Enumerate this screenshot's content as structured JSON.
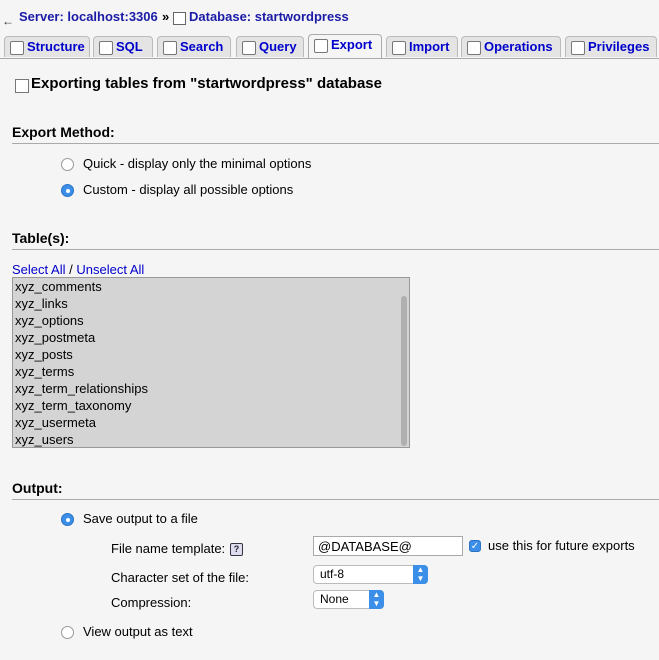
{
  "breadcrumb": {
    "back_arrow": "←",
    "server": "Server: localhost:3306",
    "separator": "»",
    "database": "Database: startwordpress"
  },
  "tabs": [
    {
      "label": "Structure",
      "icon": "structure-icon"
    },
    {
      "label": "SQL",
      "icon": "sql-icon"
    },
    {
      "label": "Search",
      "icon": "search-icon"
    },
    {
      "label": "Query",
      "icon": "query-icon"
    },
    {
      "label": "Export",
      "icon": "export-icon",
      "active": true
    },
    {
      "label": "Import",
      "icon": "import-icon"
    },
    {
      "label": "Operations",
      "icon": "operations-icon"
    },
    {
      "label": "Privileges",
      "icon": "privileges-icon"
    }
  ],
  "page_title": "Exporting tables from \"startwordpress\" database",
  "export_method": {
    "heading": "Export Method:",
    "options": [
      {
        "label": "Quick - display only the minimal options",
        "selected": false
      },
      {
        "label": "Custom - display all possible options",
        "selected": true
      }
    ]
  },
  "tables": {
    "heading": "Table(s):",
    "select_all": "Select All",
    "divider": "/",
    "unselect_all": "Unselect All",
    "items": [
      "xyz_comments",
      "xyz_links",
      "xyz_options",
      "xyz_postmeta",
      "xyz_posts",
      "xyz_terms",
      "xyz_term_relationships",
      "xyz_term_taxonomy",
      "xyz_usermeta",
      "xyz_users"
    ]
  },
  "output": {
    "heading": "Output:",
    "save_to_file": {
      "label": "Save output to a file",
      "selected": true
    },
    "file_name_template_label": "File name template:",
    "file_name_template_value": "@DATABASE@",
    "use_for_future_label": "use this for future exports",
    "use_for_future_checked": true,
    "charset_label": "Character set of the file:",
    "charset_value": "utf-8",
    "compression_label": "Compression:",
    "compression_value": "None",
    "view_as_text": {
      "label": "View output as text",
      "selected": false
    }
  },
  "colors": {
    "link": "#0000cc",
    "accent": "#3b8fe8",
    "background": "#f5f5f5"
  }
}
